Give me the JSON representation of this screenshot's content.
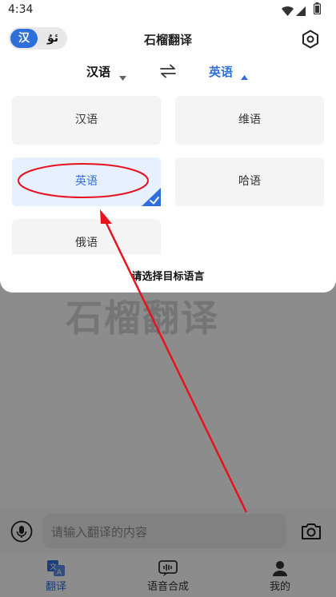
{
  "status": {
    "time": "4:34"
  },
  "header": {
    "title": "石榴翻译",
    "mode_toggle": {
      "active": "汉",
      "inactive": "ئۇ"
    }
  },
  "language_bar": {
    "source": "汉语",
    "target": "英语"
  },
  "language_options": [
    "汉语",
    "维语",
    "英语",
    "哈语",
    "俄语"
  ],
  "selected_language": "英语",
  "sheet_footer": "请选择目标语言",
  "watermark": "石榴翻译",
  "input": {
    "placeholder": "请输入翻译的内容"
  },
  "tabs": [
    {
      "label": "翻译",
      "active": true
    },
    {
      "label": "语音合成",
      "active": false
    },
    {
      "label": "我的",
      "active": false
    }
  ],
  "colors": {
    "accent": "#2f6fdc",
    "annotation": "#e8121f"
  }
}
